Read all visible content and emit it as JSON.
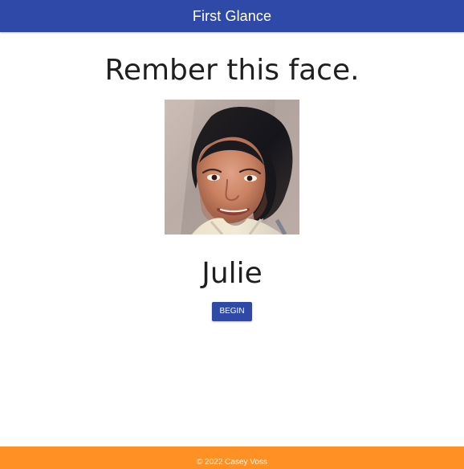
{
  "header": {
    "title": "First Glance"
  },
  "main": {
    "prompt": "Rember this face.",
    "photo_alt": "Julie",
    "name": "Julie",
    "begin_label": "BEGIN"
  },
  "footer": {
    "copyright": "© 2022 Casey Voss"
  },
  "colors": {
    "header": "#2f49a8",
    "button": "#2f49a8",
    "footer": "#ff9124"
  }
}
